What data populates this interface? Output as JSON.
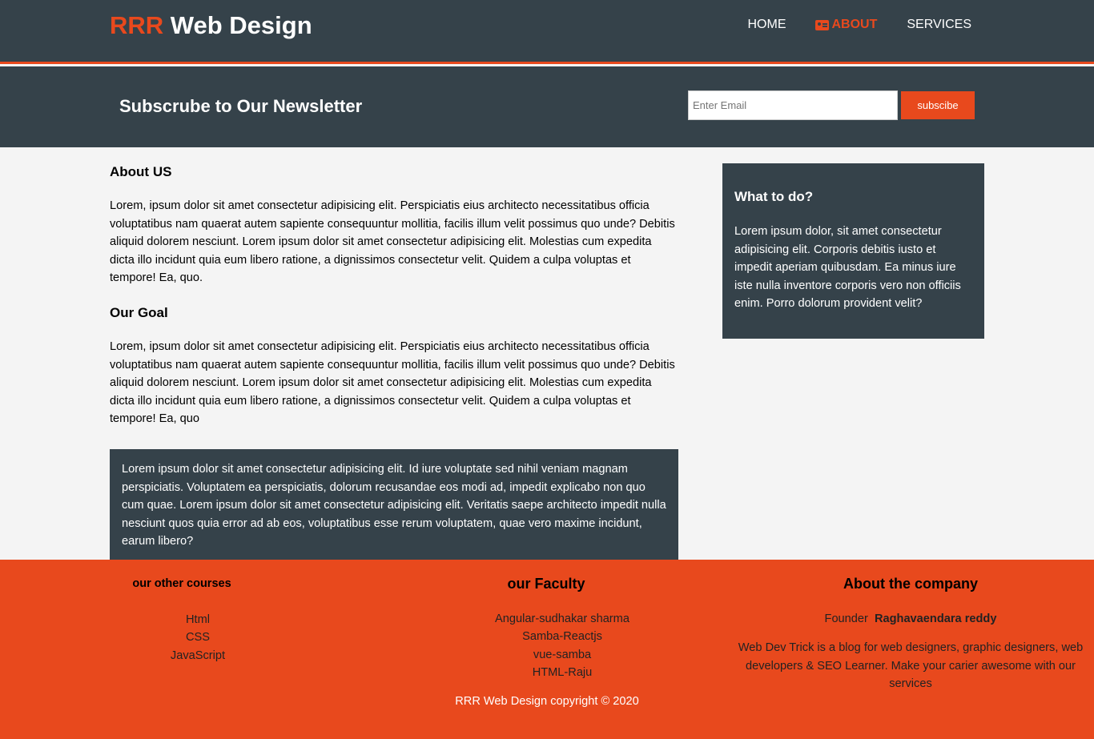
{
  "header": {
    "brand_highlight": "RRR",
    "brand_rest": " Web Design",
    "nav": [
      {
        "label": "HOME",
        "active": false
      },
      {
        "label": "ABOUT",
        "active": true,
        "icon": "id-card-icon"
      },
      {
        "label": "SERVICES",
        "active": false
      }
    ]
  },
  "newsletter": {
    "title": "Subscrube to Our Newsletter",
    "input_placeholder": "Enter Email",
    "button_label": "subscibe"
  },
  "main": {
    "about_heading": "About US",
    "about_text": "Lorem, ipsum dolor sit amet consectetur adipisicing elit. Perspiciatis eius architecto necessitatibus officia voluptatibus nam quaerat autem sapiente consequuntur mollitia, facilis illum velit possimus quo unde? Debitis aliquid dolorem nesciunt. Lorem ipsum dolor sit amet consectetur adipisicing elit. Molestias cum expedita dicta illo incidunt quia eum libero ratione, a dignissimos consectetur velit. Quidem a culpa voluptas et tempore! Ea, quo.",
    "goal_heading": "Our Goal",
    "goal_text": "Lorem, ipsum dolor sit amet consectetur adipisicing elit. Perspiciatis eius architecto necessitatibus officia voluptatibus nam quaerat autem sapiente consequuntur mollitia, facilis illum velit possimus quo unde? Debitis aliquid dolorem nesciunt. Lorem ipsum dolor sit amet consectetur adipisicing elit. Molestias cum expedita dicta illo incidunt quia eum libero ratione, a dignissimos consectetur velit. Quidem a culpa voluptas et tempore! Ea, quo",
    "box_text": "Lorem ipsum dolor sit amet consectetur adipisicing elit. Id iure voluptate sed nihil veniam magnam perspiciatis. Voluptatem ea perspiciatis, dolorum recusandae eos modi ad, impedit explicabo non quo cum quae. Lorem ipsum dolor sit amet consectetur adipisicing elit. Veritatis saepe architecto impedit nulla nesciunt quos quia error ad ab eos, voluptatibus esse rerum voluptatem, quae vero maxime incidunt, earum libero?"
  },
  "sidebar": {
    "heading": "What to do?",
    "text": "Lorem ipsum dolor, sit amet consectetur adipisicing elit. Corporis debitis iusto et impedit aperiam quibusdam. Ea minus iure iste nulla inventore corporis vero non officiis enim. Porro dolorum provident velit?"
  },
  "footer": {
    "courses_heading": "our other courses",
    "courses": [
      "Html",
      "CSS",
      "JavaScript"
    ],
    "faculty_heading": "our Faculty",
    "faculty": [
      "Angular-sudhakar sharma",
      "Samba-Reactjs",
      "vue-samba",
      "HTML-Raju"
    ],
    "company_heading": "About the company",
    "founder_label": "Founder",
    "founder_name": "Raghavaendara reddy",
    "company_text": "Web Dev Trick is a blog for web designers, graphic designers, web developers & SEO Learner. Make your carier awesome with our services",
    "copyright": "RRR Web Design copyright © 2020"
  },
  "colors": {
    "dark": "#35424a",
    "accent": "#e8491d",
    "bg": "#f4f4f4"
  }
}
